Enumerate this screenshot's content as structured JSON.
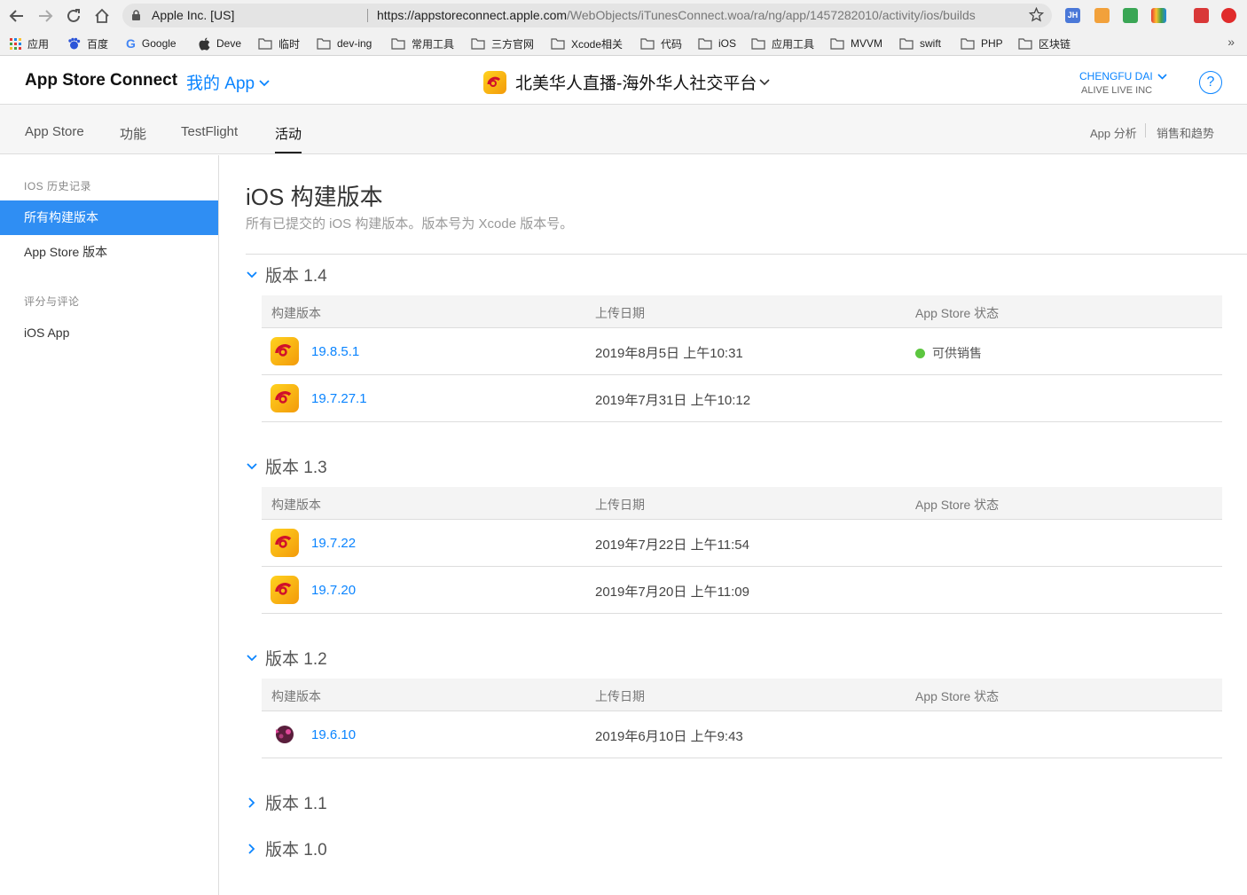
{
  "browser": {
    "org_label": "Apple Inc. [US]",
    "url_host": "https://appstoreconnect.apple.com",
    "url_path": "/WebObjects/iTunesConnect.woa/ra/ng/app/1457282010/activity/ios/builds"
  },
  "bookmarks": [
    {
      "label": "应用",
      "icon": "apps-grid-icon"
    },
    {
      "label": "百度",
      "icon": "baidu-icon"
    },
    {
      "label": "Google",
      "icon": "google-icon"
    },
    {
      "label": "Deve",
      "icon": "apple-icon"
    },
    {
      "label": "临时",
      "icon": "folder-icon"
    },
    {
      "label": "dev-ing",
      "icon": "folder-icon"
    },
    {
      "label": "常用工具",
      "icon": "folder-icon"
    },
    {
      "label": "三方官网",
      "icon": "folder-icon"
    },
    {
      "label": "Xcode相关",
      "icon": "folder-icon"
    },
    {
      "label": "代码",
      "icon": "folder-icon"
    },
    {
      "label": "iOS",
      "icon": "folder-icon"
    },
    {
      "label": "应用工具",
      "icon": "folder-icon"
    },
    {
      "label": "MVVM",
      "icon": "folder-icon"
    },
    {
      "label": "swift",
      "icon": "folder-icon"
    },
    {
      "label": "PHP",
      "icon": "folder-icon"
    },
    {
      "label": "区块链",
      "icon": "folder-icon"
    }
  ],
  "bookmarks_more": "»",
  "header": {
    "brand": "App Store Connect",
    "my_apps": "我的 App",
    "app_name": "北美华人直播-海外华人社交平台",
    "user_name": "CHENGFU DAI",
    "user_org": "ALIVE LIVE INC",
    "help": "?"
  },
  "tabs": {
    "left": [
      "App Store",
      "功能",
      "TestFlight",
      "活动"
    ],
    "active": "活动",
    "right": [
      "App 分析",
      "销售和趋势"
    ]
  },
  "sidebar": {
    "section1": "IOS 历史记录",
    "items1": [
      "所有构建版本",
      "App Store 版本"
    ],
    "section2": "评分与评论",
    "items2": [
      "iOS App"
    ]
  },
  "main": {
    "title": "iOS 构建版本",
    "subtitle": "所有已提交的 iOS 构建版本。版本号为 Xcode 版本号。",
    "columns": [
      "构建版本",
      "上传日期",
      "App Store 状态"
    ],
    "versions": [
      {
        "label": "版本 1.4",
        "expanded": true,
        "builds": [
          {
            "build": "19.8.5.1",
            "date": "2019年8月5日 上午10:31",
            "status": "可供销售"
          },
          {
            "build": "19.7.27.1",
            "date": "2019年7月31日 上午10:12",
            "status": ""
          }
        ]
      },
      {
        "label": "版本 1.3",
        "expanded": true,
        "builds": [
          {
            "build": "19.7.22",
            "date": "2019年7月22日 上午11:54",
            "status": ""
          },
          {
            "build": "19.7.20",
            "date": "2019年7月20日 上午11:09",
            "status": ""
          }
        ]
      },
      {
        "label": "版本 1.2",
        "expanded": true,
        "builds": [
          {
            "build": "19.6.10",
            "date": "2019年6月10日 上午9:43",
            "status": ""
          }
        ]
      },
      {
        "label": "版本 1.1",
        "expanded": false,
        "builds": []
      },
      {
        "label": "版本 1.0",
        "expanded": false,
        "builds": []
      }
    ]
  },
  "colors": {
    "accent": "#0a84ff",
    "sidebar_selected": "#2f8ef3",
    "status_ready": "#5cc63f"
  }
}
